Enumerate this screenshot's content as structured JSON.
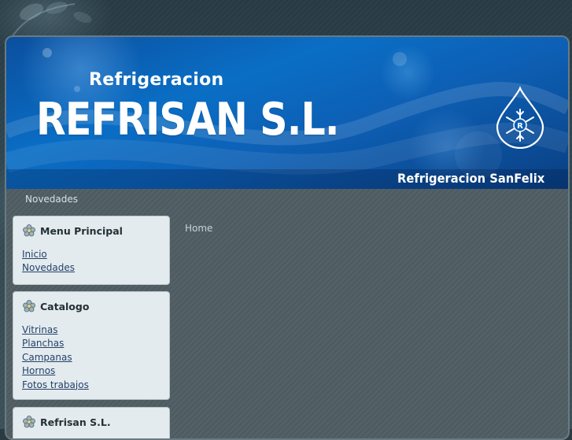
{
  "header": {
    "subtitle": "Refrigeracion",
    "title": "REFRISAN S.L.",
    "footer_text": "Refrigeracion SanFelix",
    "logo_letter": "R"
  },
  "nav": {
    "item": "Novedades"
  },
  "breadcrumb": {
    "label": "Home"
  },
  "modules": [
    {
      "title": "Menu Principal",
      "icon": "flower-icon",
      "links": [
        "Inicio",
        "Novedades"
      ]
    },
    {
      "title": "Catalogo",
      "icon": "flower-icon",
      "links": [
        "Vitrinas",
        "Planchas",
        "Campanas",
        "Hornos",
        "Fotos trabajos"
      ]
    },
    {
      "title": "Refrisan S.L.",
      "icon": "flower-icon",
      "links": []
    }
  ],
  "colors": {
    "banner_blue": "#0a6ec5",
    "module_bg": "#e3ebee",
    "link": "#25426a",
    "page_bg": "#4e5c62"
  }
}
